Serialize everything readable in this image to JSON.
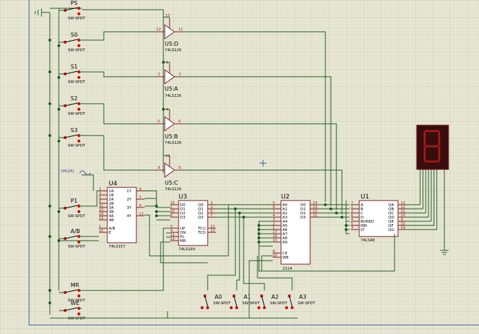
{
  "switches": {
    "ps": {
      "label": "PS",
      "type": "SW-SPDT"
    },
    "s0": {
      "label": "S0",
      "type": "SW-SPDT"
    },
    "s1": {
      "label": "S1",
      "type": "SW-SPDT"
    },
    "s2": {
      "label": "S2",
      "type": "SW-SPDT"
    },
    "s3": {
      "label": "S3",
      "type": "SW-SPDT"
    },
    "p1": {
      "label": "P1",
      "type": "SW-SPDT"
    },
    "ab": {
      "label": "A/B",
      "type": "SW-SPDT"
    },
    "mr": {
      "label": "MR",
      "type": "SW-SPDT"
    },
    "we": {
      "label": "WE",
      "type": "SW-SPDT"
    },
    "a0": {
      "label": "A0",
      "type": "SW-SPDT"
    },
    "a1": {
      "label": "A1",
      "type": "SW-SPDT"
    },
    "a2": {
      "label": "A2",
      "type": "SW-SPDT"
    },
    "a3": {
      "label": "A3",
      "type": "SW-SPDT"
    }
  },
  "buffers": {
    "d": {
      "name": "U5:D",
      "part": "74LS126",
      "pin_in": "12",
      "pin_out": "11",
      "pin_en": "13"
    },
    "a": {
      "name": "U5:A",
      "part": "74LS126",
      "pin_in": "2",
      "pin_out": "3",
      "pin_en": "1"
    },
    "b": {
      "name": "U5:B",
      "part": "74LS126",
      "pin_in": "5",
      "pin_out": "6",
      "pin_en": "4"
    },
    "c": {
      "name": "U5:C",
      "part": "74LS126",
      "pin_in": "9",
      "pin_out": "8",
      "pin_en": "10"
    }
  },
  "probe_label": "U4(1A)",
  "u4": {
    "name": "U4",
    "part": "74LS157",
    "left_pins": [
      "1A",
      "1B",
      "2A",
      "2B",
      "3A",
      "3B",
      "4A",
      "4B",
      "A/B",
      "E"
    ],
    "left_nums": [
      "2",
      "3",
      "5",
      "6",
      "11",
      "10",
      "14",
      "13",
      "1",
      "15"
    ],
    "right_pins": [
      "1Y",
      "2Y",
      "3Y",
      "4Y"
    ],
    "right_nums": [
      "4",
      "7",
      "9",
      "12"
    ]
  },
  "u3": {
    "name": "U3",
    "part": "74LS193",
    "left_pins": [
      "D0",
      "D1",
      "D2",
      "D3",
      "UP",
      "DN",
      "PL",
      "MR"
    ],
    "left_nums": [
      "15",
      "1",
      "10",
      "9",
      "5",
      "4",
      "11",
      "14"
    ],
    "right_pins": [
      "Q0",
      "Q1",
      "Q2",
      "Q3",
      "TCU",
      "TCD"
    ],
    "right_nums": [
      "3",
      "2",
      "6",
      "7",
      "12",
      "13"
    ]
  },
  "u2": {
    "name": "U2",
    "part": "2114",
    "left_pins": [
      "A0",
      "A1",
      "A2",
      "A3",
      "A4",
      "A5",
      "A6",
      "A7",
      "A8",
      "A9",
      "CE",
      "WE"
    ],
    "left_nums": [
      "5",
      "6",
      "7",
      "4",
      "3",
      "2",
      "1",
      "17",
      "16",
      "15",
      "8",
      "10"
    ],
    "right_pins": [
      "D0",
      "D1",
      "D2",
      "D3"
    ],
    "right_nums": [
      "14",
      "13",
      "12",
      "11"
    ]
  },
  "u1": {
    "name": "U1",
    "part": "74LS48",
    "left_pins": [
      "A",
      "B",
      "C",
      "D",
      "BI/RBO",
      "RBI",
      "LT"
    ],
    "left_nums": [
      "7",
      "1",
      "2",
      "6",
      "4",
      "5",
      "3"
    ],
    "right_pins": [
      "QA",
      "QB",
      "QC",
      "QD",
      "QE",
      "QF",
      "QG"
    ],
    "right_nums": [
      "13",
      "12",
      "11",
      "10",
      "9",
      "15",
      "14"
    ]
  },
  "display": {
    "digit": "8",
    "color": "#cc1111"
  },
  "colors": {
    "wire": "#1f5a1f",
    "chip_outline": "#7a1b1b",
    "grid_bg": "#e6e6d4"
  }
}
